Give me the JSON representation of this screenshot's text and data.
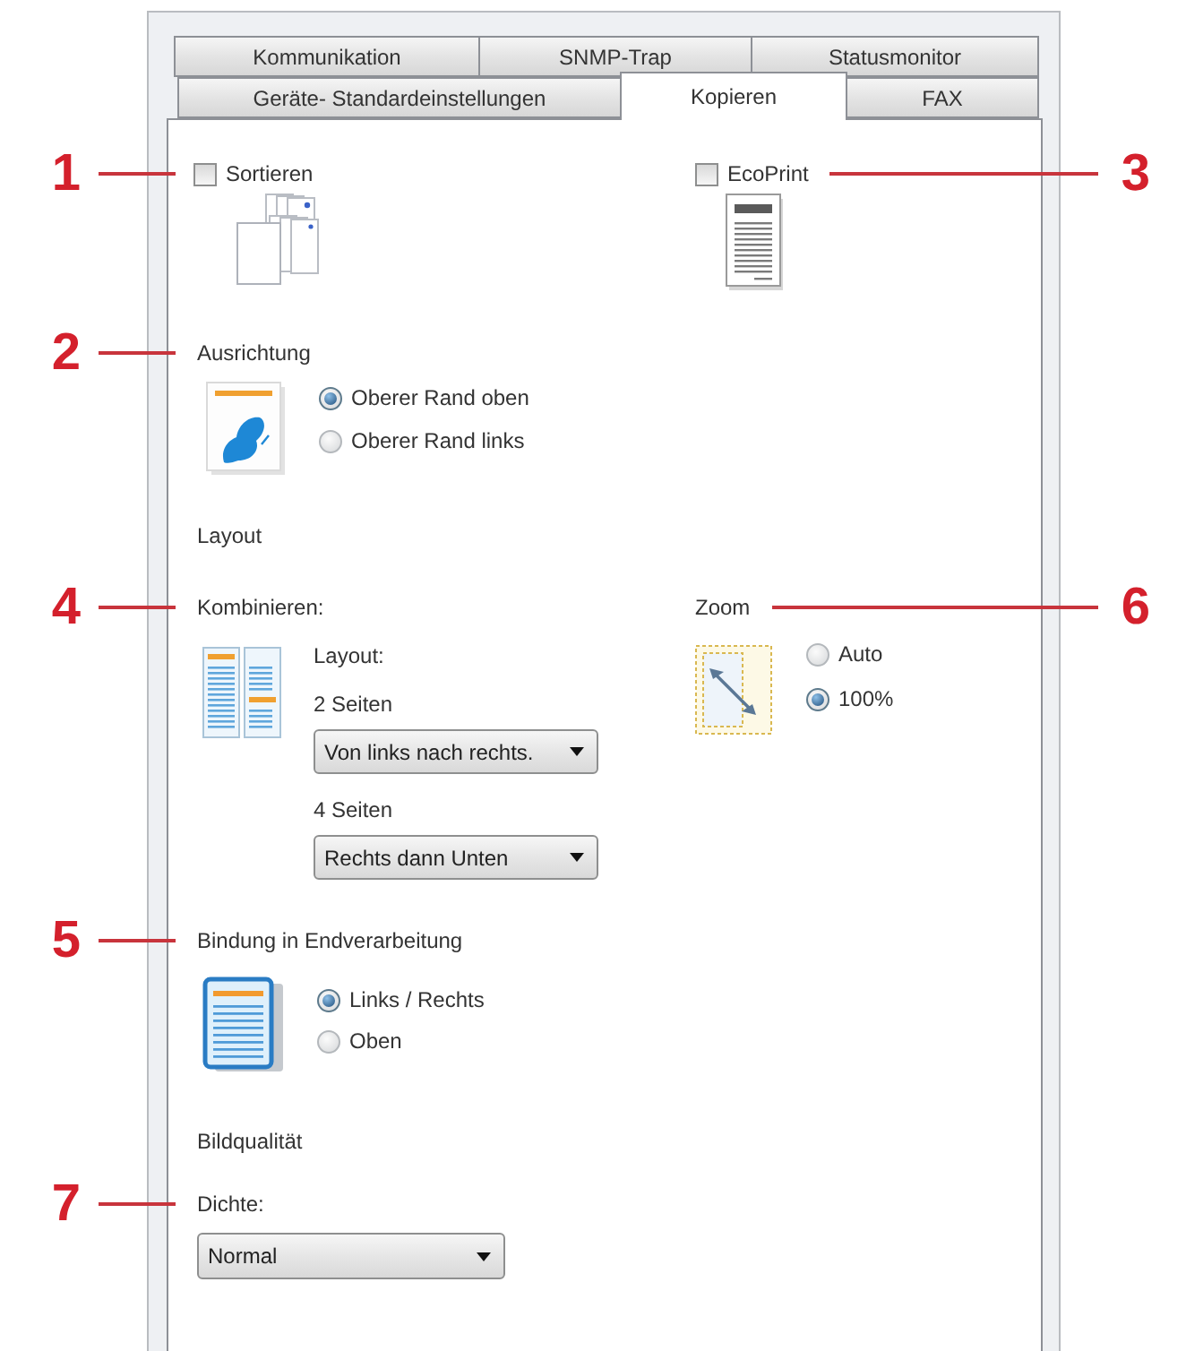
{
  "tab_rows": [
    {
      "tabs": [
        {
          "label": "Kommunikation",
          "selected": false
        },
        {
          "label": "SNMP-Trap",
          "selected": false
        },
        {
          "label": "Statusmonitor",
          "selected": false
        }
      ]
    },
    {
      "tabs": [
        {
          "label": "Geräte- Standardeinstellungen",
          "selected": false
        },
        {
          "label": "Kopieren",
          "selected": true
        },
        {
          "label": "FAX",
          "selected": false
        }
      ]
    }
  ],
  "sort": {
    "label": "Sortieren",
    "checked": false,
    "callout": "1"
  },
  "ecoprint": {
    "label": "EcoPrint",
    "checked": false,
    "callout": "3"
  },
  "orientation": {
    "heading": "Ausrichtung",
    "callout": "2",
    "options": [
      {
        "label": "Oberer Rand oben",
        "selected": true
      },
      {
        "label": "Oberer Rand links",
        "selected": false
      }
    ]
  },
  "layout_group": {
    "heading": "Layout"
  },
  "combine": {
    "heading": "Kombinieren:",
    "callout": "4",
    "layout_label": "Layout:",
    "fields": [
      {
        "label": "2 Seiten",
        "value": "Von links nach rechts."
      },
      {
        "label": "4 Seiten",
        "value": "Rechts dann Unten"
      }
    ]
  },
  "zoom": {
    "heading": "Zoom",
    "callout": "6",
    "options": [
      {
        "label": "Auto",
        "selected": false
      },
      {
        "label": "100%",
        "selected": true
      }
    ]
  },
  "binding": {
    "heading": "Bindung in Endverarbeitung",
    "callout": "5",
    "options": [
      {
        "label": "Links / Rechts",
        "selected": true
      },
      {
        "label": "Oben",
        "selected": false
      }
    ]
  },
  "image_quality_group": {
    "heading": "Bildqualität"
  },
  "density": {
    "label": "Dichte:",
    "callout": "7",
    "value": "Normal"
  }
}
